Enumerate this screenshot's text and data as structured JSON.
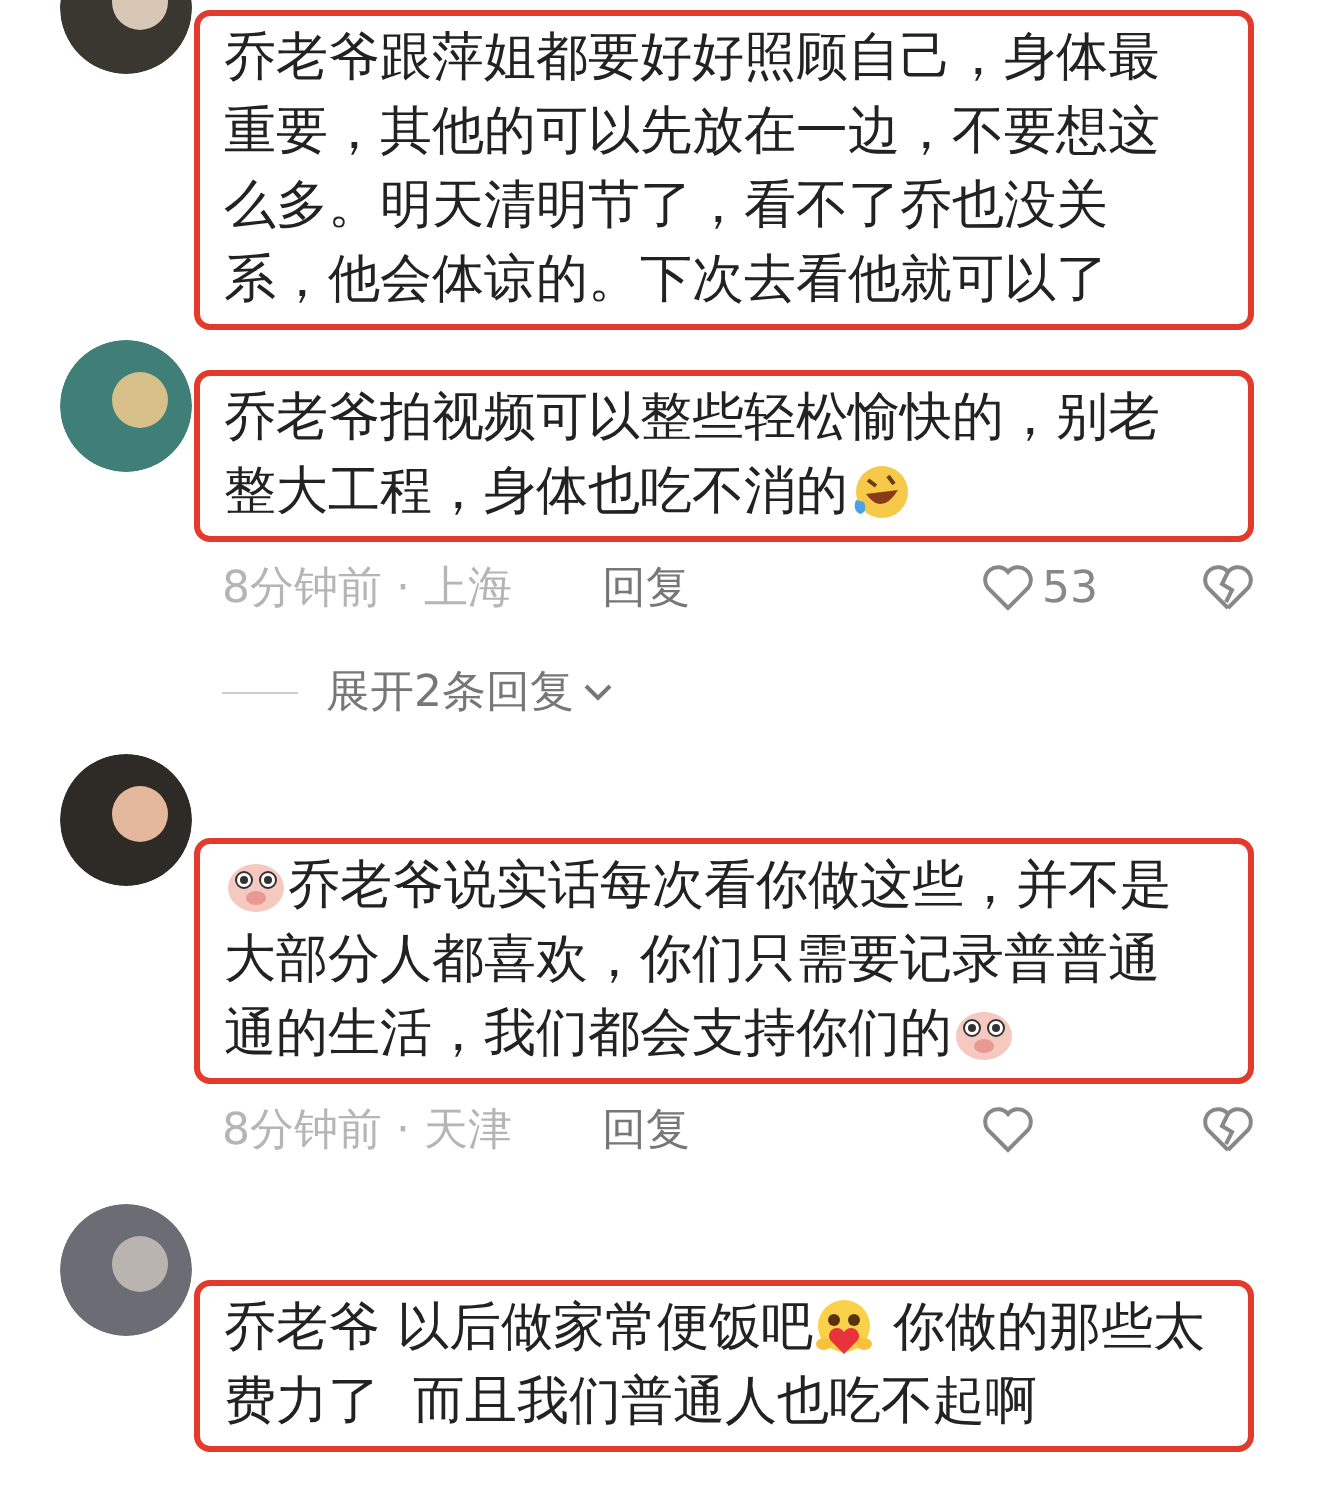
{
  "comments": [
    {
      "lines": [
        [
          {
            "kind": "text",
            "text": "乔老爷跟萍姐都要好好照顾自己，身体最"
          }
        ],
        [
          {
            "kind": "text",
            "text": "重要，其他的可以先放在一边，不要想这"
          }
        ],
        [
          {
            "kind": "text",
            "text": "么多。明天清明节了，看不了乔也没关"
          }
        ],
        [
          {
            "kind": "text",
            "text": "系，他会体谅的。下次去看他就可以了"
          }
        ]
      ]
    },
    {
      "lines": [
        [
          {
            "kind": "text",
            "text": "乔老爷拍视频可以整些轻松愉快的，别老"
          }
        ],
        [
          {
            "kind": "text",
            "text": "整大工程，身体也吃不消的"
          },
          {
            "kind": "laugh"
          }
        ]
      ],
      "meta": {
        "time_location": "8分钟前 · 上海",
        "reply": "回复",
        "likes": "53"
      },
      "expand": {
        "label": "展开2条回复"
      }
    },
    {
      "lines": [
        [
          {
            "kind": "pig"
          },
          {
            "kind": "text",
            "text": "乔老爷说实话每次看你做这些，并不是"
          }
        ],
        [
          {
            "kind": "text",
            "text": "大部分人都喜欢，你们只需要记录普普通"
          }
        ],
        [
          {
            "kind": "text",
            "text": "通的生活，我们都会支持你们的"
          },
          {
            "kind": "pig"
          }
        ]
      ],
      "meta": {
        "time_location": "8分钟前 · 天津",
        "reply": "回复"
      }
    },
    {
      "lines": [
        [
          {
            "kind": "text",
            "text": "乔老爷 以后做家常便饭吧"
          },
          {
            "kind": "hug"
          },
          {
            "kind": "text",
            "text": " 你做的那些太"
          }
        ],
        [
          {
            "kind": "text",
            "text": "费力了  而且我们普通人也吃不起啊"
          }
        ]
      ]
    }
  ]
}
